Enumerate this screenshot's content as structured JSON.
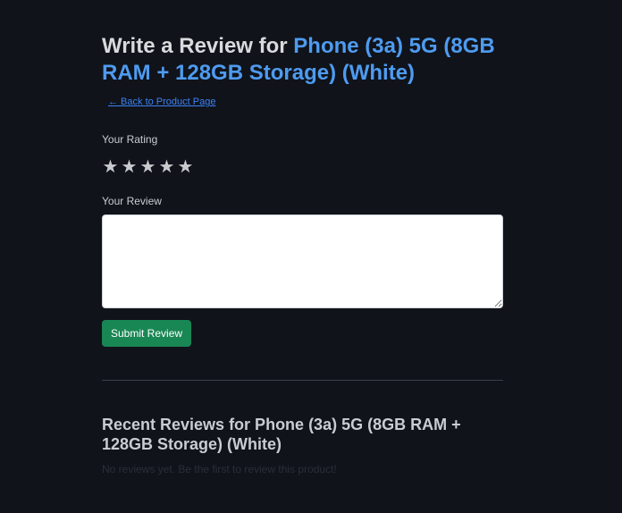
{
  "header": {
    "title_prefix": "Write a Review for ",
    "product_name": "Phone (3a) 5G (8GB RAM + 128GB Storage) (White)",
    "back_link": "← Back to Product Page"
  },
  "form": {
    "rating_label": "Your Rating",
    "stars": [
      "★",
      "★",
      "★",
      "★",
      "★"
    ],
    "review_label": "Your Review",
    "review_value": "",
    "submit_label": "Submit Review"
  },
  "recent": {
    "title": "Recent Reviews for Phone (3a) 5G (8GB RAM + 128GB Storage) (White)",
    "empty_message": "No reviews yet. Be the first to review this product!"
  },
  "colors": {
    "background": "#10131a",
    "accent": "#4e9bf0",
    "link": "#3b82f6",
    "submit": "#198754"
  }
}
